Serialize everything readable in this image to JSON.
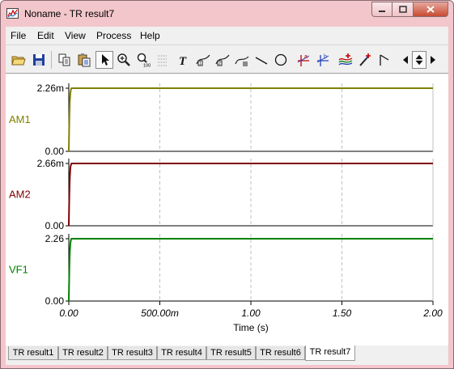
{
  "window": {
    "title": "Noname - TR result7"
  },
  "menu": [
    "File",
    "Edit",
    "View",
    "Process",
    "Help"
  ],
  "toolbar_icons": [
    "open-icon",
    "save-icon",
    "copy-icon",
    "paste-icon",
    "pointer-icon",
    "zoom-in-icon",
    "zoom-100-icon",
    "grid-icon",
    "text-icon",
    "curve-label-icon",
    "curve-label-2-icon",
    "curve-label-3-icon",
    "line-icon",
    "circle-icon",
    "cursor-a-icon",
    "cursor-b-icon",
    "add-curve-icon",
    "add-marker-icon",
    "flag-icon",
    "scroll-left-icon",
    "scroll-updown-icon",
    "scroll-right-icon"
  ],
  "colors": {
    "AM1": "#808000",
    "AM2": "#800000",
    "VF1": "#008000",
    "grid": "#c0c0c0"
  },
  "chart_data": [
    {
      "type": "line",
      "name": "AM1",
      "ylabel": "AM1",
      "yticks": [
        "2.26m",
        "0.00"
      ],
      "ylim": [
        0,
        0.00226
      ],
      "xlim": [
        0,
        2.0
      ],
      "x": [
        0,
        0.003,
        0.006,
        0.009,
        0.012,
        0.015,
        0.02,
        2.0
      ],
      "y": [
        0,
        0.0012,
        0.0018,
        0.0021,
        0.00222,
        0.00226,
        0.00226,
        0.00226
      ]
    },
    {
      "type": "line",
      "name": "AM2",
      "ylabel": "AM2",
      "yticks": [
        "2.66m",
        "0.00"
      ],
      "ylim": [
        0,
        0.00266
      ],
      "xlim": [
        0,
        2.0
      ],
      "x": [
        0,
        0.003,
        0.006,
        0.009,
        0.012,
        0.015,
        0.02,
        2.0
      ],
      "y": [
        0,
        0.0014,
        0.0021,
        0.0025,
        0.0026,
        0.00266,
        0.00266,
        0.00266
      ]
    },
    {
      "type": "line",
      "name": "VF1",
      "ylabel": "VF1",
      "yticks": [
        "2.26",
        "0.00"
      ],
      "ylim": [
        0,
        2.26
      ],
      "xlim": [
        0,
        2.0
      ],
      "x": [
        0,
        0.003,
        0.006,
        0.009,
        0.012,
        0.015,
        0.02,
        2.0
      ],
      "y": [
        0,
        1.2,
        1.8,
        2.1,
        2.22,
        2.26,
        2.26,
        2.26
      ],
      "xticks": [
        "0.00",
        "500.00m",
        "1.00",
        "1.50",
        "2.00"
      ],
      "xtick_values": [
        0,
        0.5,
        1.0,
        1.5,
        2.0
      ],
      "xlabel": "Time (s)"
    }
  ],
  "tabs": [
    "TR result1",
    "TR result2",
    "TR result3",
    "TR result4",
    "TR result5",
    "TR result6",
    "TR result7"
  ],
  "active_tab": "TR result7"
}
